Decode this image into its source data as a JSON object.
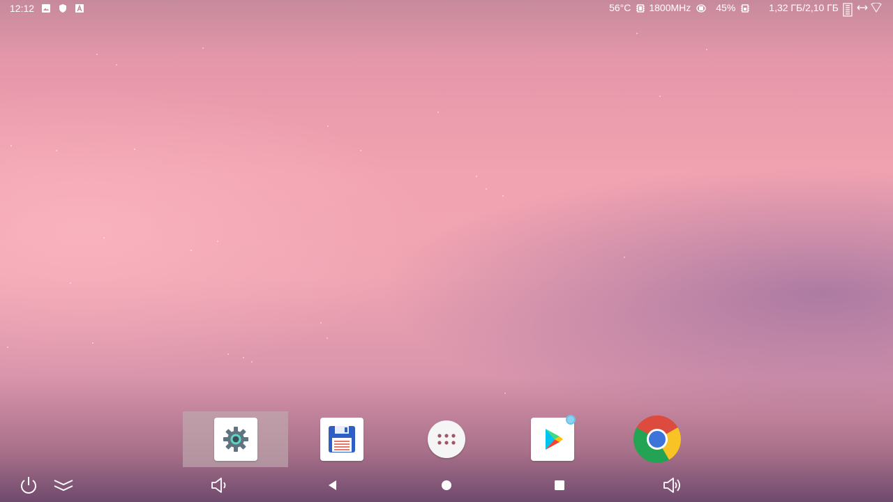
{
  "status_bar": {
    "time": "12:12",
    "left_icons": [
      "image-icon",
      "shield-icon",
      "text-a-icon"
    ],
    "temperature": "56°C",
    "cpu_freq": "1800MHz",
    "cpu_load": "45%",
    "memory": "1,32 ГБ/2,10 ГБ",
    "right_icons": [
      "cpu-chip-icon",
      "cpu-chip-icon",
      "cpu-chip-icon",
      "ram-icon",
      "data-transfer-icon",
      "wifi-icon"
    ]
  },
  "dock": {
    "selected_index": 0,
    "apps": [
      {
        "name": "settings",
        "icon": "settings-gear-icon"
      },
      {
        "name": "file-manager",
        "icon": "floppy-disk-icon"
      },
      {
        "name": "app-drawer",
        "icon": "app-drawer-dots-icon"
      },
      {
        "name": "play-store",
        "icon": "play-store-icon",
        "badge": true
      },
      {
        "name": "chrome",
        "icon": "chrome-icon"
      }
    ]
  },
  "nav_bar": {
    "buttons": [
      "power-icon",
      "collapse-chevrons-icon",
      "volume-down-icon",
      "back-triangle-icon",
      "home-circle-icon",
      "recents-square-icon",
      "volume-up-icon"
    ]
  },
  "colors": {
    "accent_blue": "#3d74d9",
    "gear_teal": "#5fd6c2",
    "badge_blue": "#8fd2f0"
  }
}
